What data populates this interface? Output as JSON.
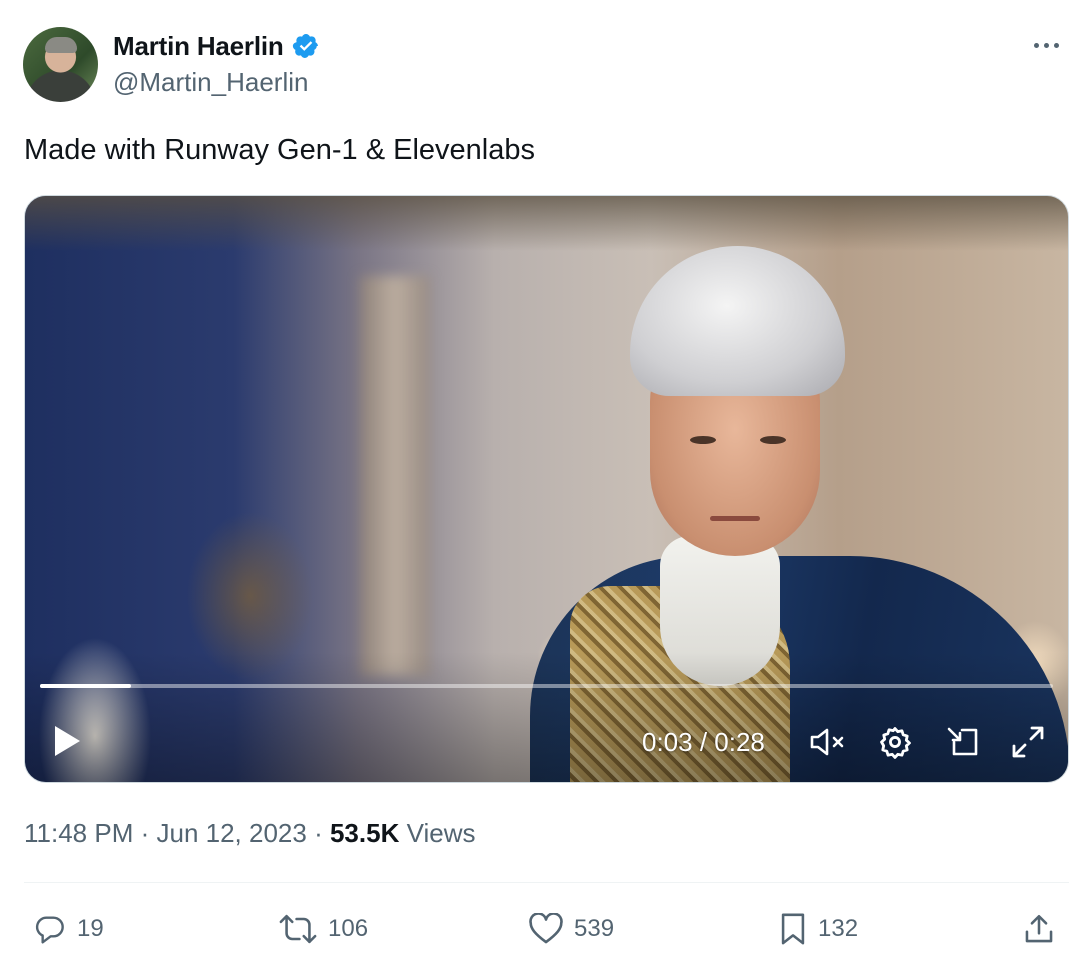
{
  "author": {
    "display_name": "Martin Haerlin",
    "handle": "@Martin_Haerlin",
    "verified_color": "#1d9bf0"
  },
  "tweet": {
    "text": "Made with Runway Gen-1 & Elevenlabs"
  },
  "video": {
    "current_time": "0:03",
    "separator": "/",
    "duration": "0:28",
    "time_display": "0:03 / 0:28",
    "progress_fraction": 0.09,
    "muted": true
  },
  "meta": {
    "time": "11:48 PM",
    "date": "Jun 12, 2023",
    "views_count": "53.5K",
    "views_label": "Views"
  },
  "actions": {
    "replies": "19",
    "retweets": "106",
    "likes": "539",
    "bookmarks": "132"
  },
  "icons": [
    "more-icon",
    "verified-icon",
    "play-icon",
    "mute-icon",
    "settings-icon",
    "pip-icon",
    "fullscreen-icon",
    "reply-icon",
    "retweet-icon",
    "like-icon",
    "bookmark-icon",
    "share-icon"
  ],
  "colors": {
    "text_primary": "#0f1419",
    "text_secondary": "#536471",
    "accent": "#1d9bf0",
    "divider": "#eff3f4"
  }
}
